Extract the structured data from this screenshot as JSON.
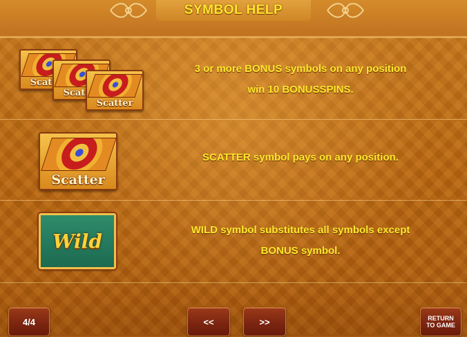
{
  "header": {
    "title": "SYMBOL HELP"
  },
  "rows": [
    {
      "symbol": "scatter-stack",
      "symbol_label": "Scatter",
      "line1": "3 or more BONUS symbols on any position",
      "line2": "win 10 BONUSSPINS."
    },
    {
      "symbol": "scatter",
      "symbol_label": "Scatter",
      "line1": "SCATTER symbol pays on any position."
    },
    {
      "symbol": "wild",
      "symbol_label": "Wild",
      "line1": "WILD symbol substitutes all symbols except",
      "line2": "BONUS symbol."
    }
  ],
  "footer": {
    "page_indicator": "4/4",
    "prev_label": "<<",
    "next_label": ">>",
    "return_line1": "RETURN",
    "return_line2": "TO GAME"
  },
  "colors": {
    "text": "#ffe82c",
    "button": "#7a2410",
    "background": "#b86a14"
  }
}
